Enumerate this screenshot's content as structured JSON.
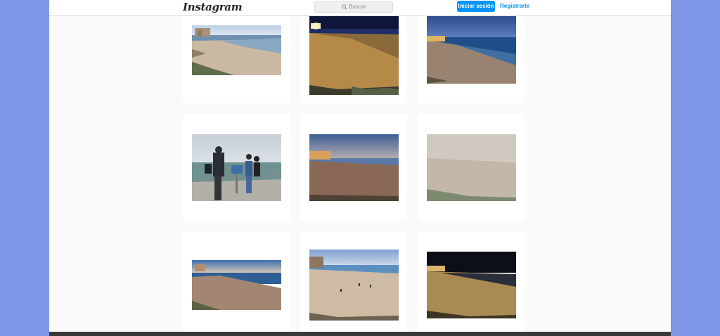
{
  "header": {
    "logo_text": "Instagram",
    "search_placeholder": "Buscar",
    "login_label": "Iniciar sesión",
    "signup_label": "Registrarte",
    "accent_color": "#0095f6"
  },
  "grid": {
    "posts": [
      {
        "name": "post-beach-daytime-buildings"
      },
      {
        "name": "post-beach-night-lights"
      },
      {
        "name": "post-beach-dusk-blue"
      },
      {
        "name": "post-people-camera-viewpoint"
      },
      {
        "name": "post-beach-sunset-wide"
      },
      {
        "name": "post-beach-fog"
      },
      {
        "name": "post-beach-cliff-sunset"
      },
      {
        "name": "post-beach-waves-walkers"
      },
      {
        "name": "post-beach-night-orange"
      }
    ]
  }
}
